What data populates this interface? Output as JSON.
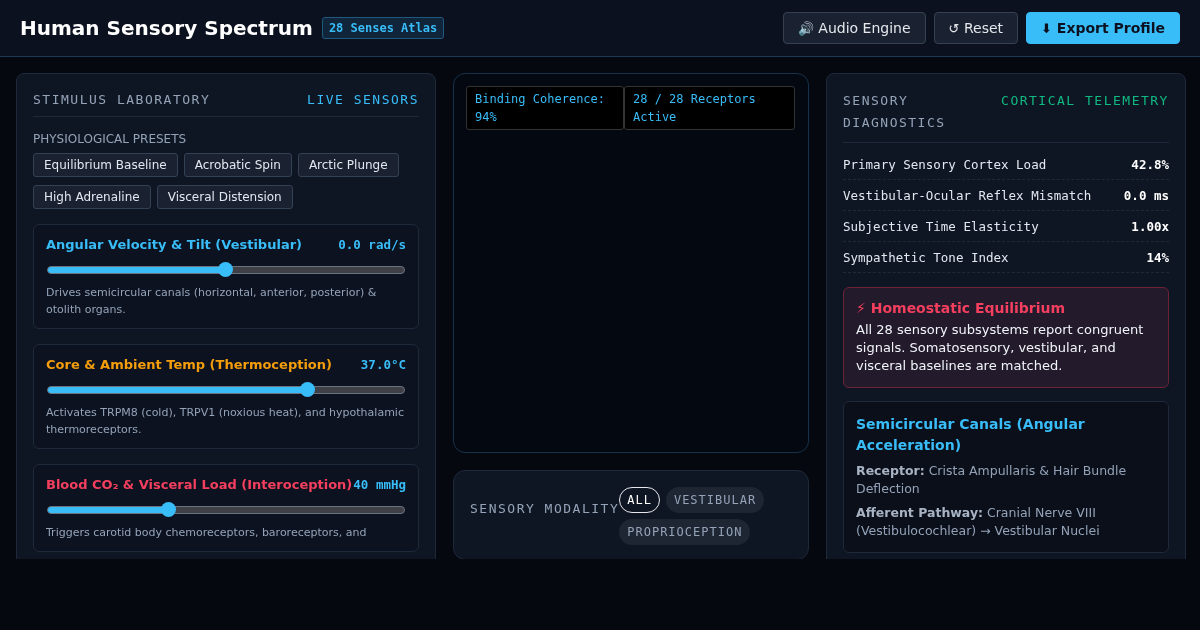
{
  "header": {
    "title": "Human Sensory Spectrum",
    "badge": "28 Senses Atlas",
    "buttons": [
      {
        "icon": "🔊",
        "label": "Audio Engine",
        "kind": "plain"
      },
      {
        "icon": "↺",
        "label": "Reset",
        "kind": "plain"
      },
      {
        "icon": "⬇",
        "label": "Export Profile",
        "kind": "primary"
      }
    ]
  },
  "lab": {
    "title": "STIMULUS LABORATORY",
    "tag": "LIVE SENSORS",
    "presets_label": "PHYSIOLOGICAL PRESETS",
    "presets": [
      "Equilibrium Baseline",
      "Acrobatic Spin",
      "Arctic Plunge",
      "High Adrenaline",
      "Visceral Distension"
    ],
    "sliders": [
      {
        "name": "Angular Velocity & Tilt (Vestibular)",
        "reading": "0.0 rad/s",
        "color": "#38bdf8",
        "level": 0.5,
        "description": "Drives semicircular canals (horizontal, anterior, posterior) & otolith organs."
      },
      {
        "name": "Core & Ambient Temp (Thermoception)",
        "reading": "37.0°C",
        "color": "#f59e0b",
        "level": 0.73,
        "description": "Activates TRPM8 (cold), TRPV1 (noxious heat), and hypothalamic thermoreceptors."
      },
      {
        "name": "Blood CO₂ & Visceral Load (Interoception)",
        "reading": "40 mmHg",
        "color": "#f43f5e",
        "level": 0.34,
        "description": "Triggers carotid body chemoreceptors, baroreceptors, and"
      }
    ]
  },
  "viewer": {
    "stats": [
      "Binding Coherence: 94%",
      "28 / 28 Receptors Active"
    ]
  },
  "modality": {
    "title": "SENSORY MODALITY",
    "filters": [
      {
        "label": "ALL",
        "selected": true
      },
      {
        "label": "VESTIBULAR",
        "selected": false
      },
      {
        "label": "PROPRIOCEPTION",
        "selected": false
      }
    ]
  },
  "diagnostics": {
    "title": "SENSORY DIAGNOSTICS",
    "tag": "CORTICAL TELEMETRY",
    "metrics": [
      {
        "label": "Primary Sensory Cortex Load",
        "value": "42.8%"
      },
      {
        "label": "Vestibular-Ocular Reflex Mismatch",
        "value": "0.0 ms"
      },
      {
        "label": "Subjective Time Elasticity",
        "value": "1.00x"
      },
      {
        "label": "Sympathetic Tone Index",
        "value": "14%"
      }
    ],
    "alert": {
      "icon": "⚡",
      "title": "Homeostatic Equilibrium",
      "text": "All 28 sensory subsystems report congruent signals. Somatosensory, vestibular, and visceral baselines are matched."
    },
    "detail": {
      "title": "Semicircular Canals (Angular Acceleration)",
      "lines": [
        "**Receptor:** Crista Ampullaris & Hair Bundle Deflection",
        "**Afferent Pathway:** Cranial Nerve VIII (Vestibulocochlear) → Vestibular Nuclei"
      ]
    }
  }
}
